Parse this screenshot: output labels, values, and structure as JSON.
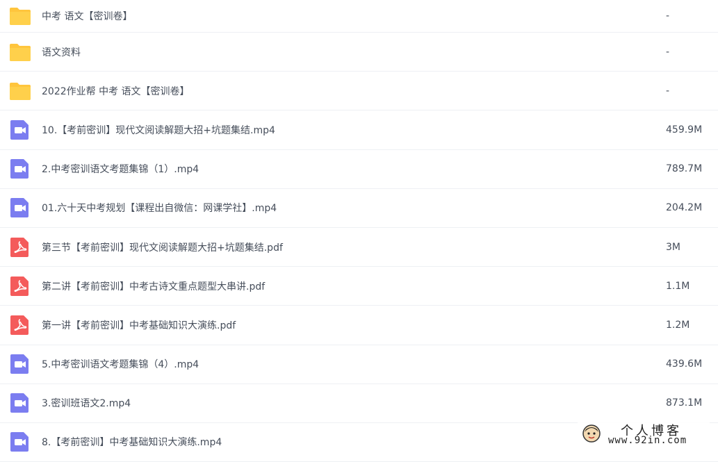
{
  "files": [
    {
      "type": "folder",
      "icon": "folder-icon",
      "name": "中考 语文【密训卷】",
      "size": "-"
    },
    {
      "type": "folder",
      "icon": "folder-icon",
      "name": "语文资料",
      "size": "-"
    },
    {
      "type": "folder",
      "icon": "folder-icon",
      "name": "2022作业帮 中考 语文【密训卷】",
      "size": "-"
    },
    {
      "type": "video",
      "icon": "video-file-icon",
      "name": "10.【考前密训】现代文阅读解题大招+坑题集结.mp4",
      "size": "459.9M"
    },
    {
      "type": "video",
      "icon": "video-file-icon",
      "name": "2.中考密训语文考题集锦（1）.mp4",
      "size": "789.7M"
    },
    {
      "type": "video",
      "icon": "video-file-icon",
      "name": "01.六十天中考规划【课程出自微信：网课学社】.mp4",
      "size": "204.2M"
    },
    {
      "type": "pdf",
      "icon": "pdf-file-icon",
      "name": "第三节【考前密训】现代文阅读解题大招+坑题集结.pdf",
      "size": "3M"
    },
    {
      "type": "pdf",
      "icon": "pdf-file-icon",
      "name": "第二讲【考前密训】中考古诗文重点题型大串讲.pdf",
      "size": "1.1M"
    },
    {
      "type": "pdf",
      "icon": "pdf-file-icon",
      "name": "第一讲【考前密训】中考基础知识大演练.pdf",
      "size": "1.2M"
    },
    {
      "type": "video",
      "icon": "video-file-icon",
      "name": "5.中考密训语文考题集锦（4）.mp4",
      "size": "439.6M"
    },
    {
      "type": "video",
      "icon": "video-file-icon",
      "name": "3.密训班语文2.mp4",
      "size": "873.1M"
    },
    {
      "type": "video",
      "icon": "video-file-icon",
      "name": "8.【考前密训】中考基础知识大演练.mp4",
      "size": ""
    }
  ],
  "watermark": {
    "title": "个人博客",
    "url": "www.92in.com"
  },
  "colors": {
    "folder": "#ffd04b",
    "video": "#7b7df0",
    "pdf": "#f45b5b",
    "text": "#454d5a",
    "divider": "#eef0f4"
  }
}
